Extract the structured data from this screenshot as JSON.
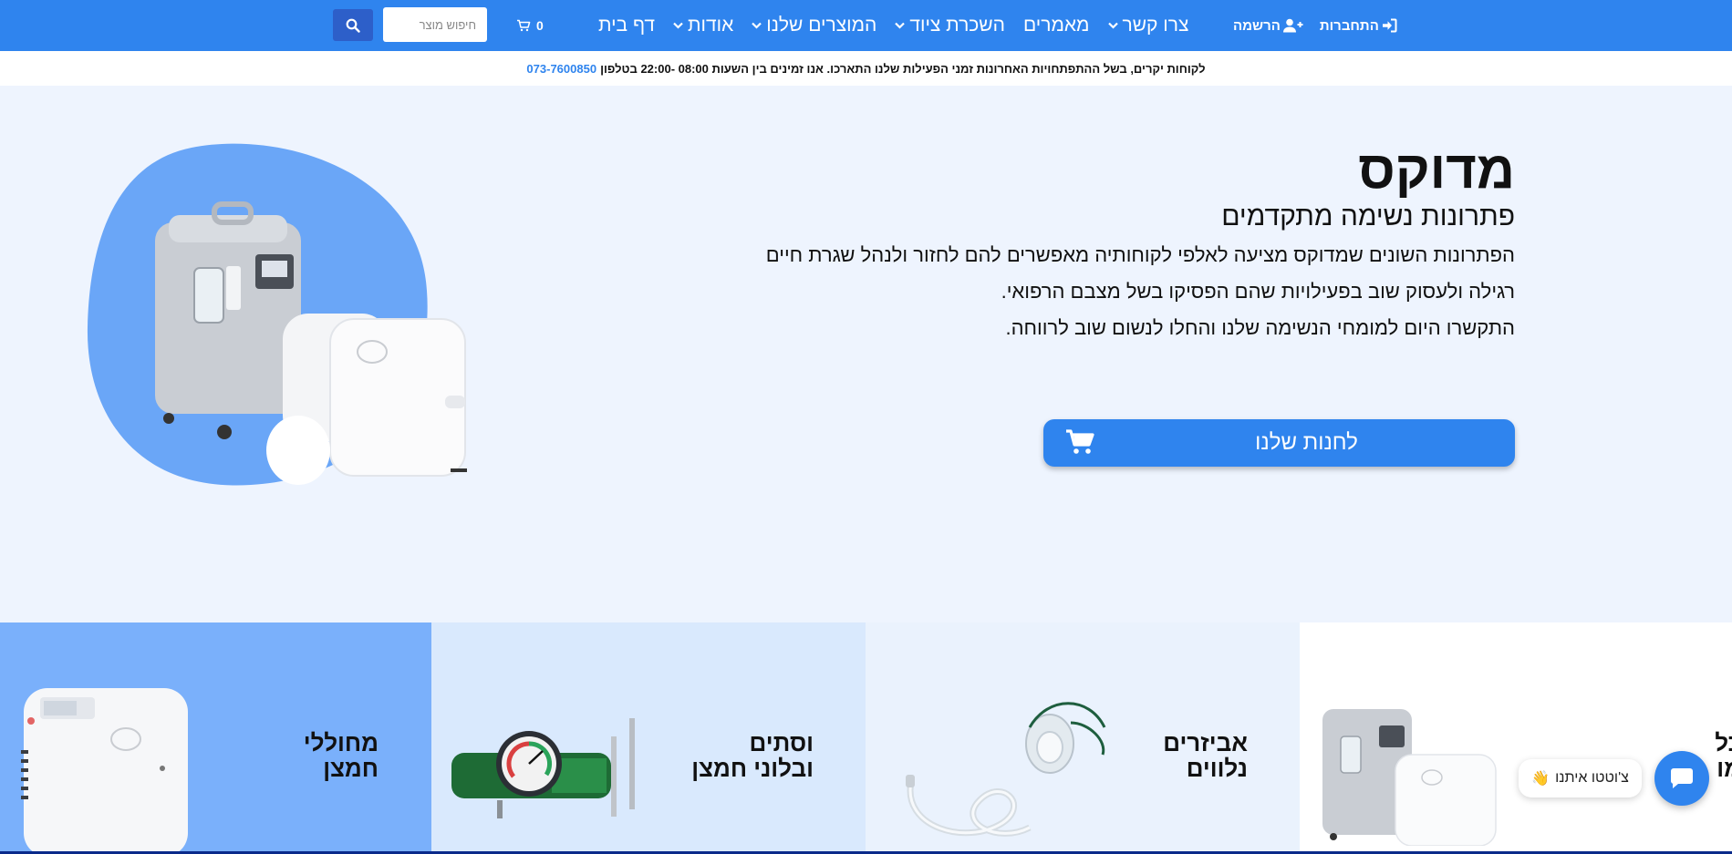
{
  "header": {
    "search_placeholder": "חיפוש מוצר",
    "cart_count": "0",
    "nav": [
      {
        "label": "דף בית",
        "has_dropdown": false
      },
      {
        "label": "אודות",
        "has_dropdown": true
      },
      {
        "label": "המוצרים שלנו",
        "has_dropdown": true
      },
      {
        "label": "השכרת ציוד",
        "has_dropdown": true
      },
      {
        "label": "מאמרים",
        "has_dropdown": false
      },
      {
        "label": "צרו קשר",
        "has_dropdown": true
      }
    ],
    "auth": {
      "register": "הרשמה",
      "login": "התחברות"
    }
  },
  "notice": {
    "text": "לקוחות יקרים, בשל ההתפתחויות האחרונות זמני הפעילות שלנו התארכו. אנו זמינים בין השעות 08:00 -22:00 בטלפון",
    "phone": "073-7600850"
  },
  "hero": {
    "title": "מדוקס",
    "subtitle": "פתרונות נשימה מתקדמים",
    "description_lines": [
      "הפתרונות השונים שמדוקס מציעה לאלפי לקוחותיה מאפשרים להם לחזור ולנהל שגרת חיים",
      "רגילה ולעסוק שוב בפעילויות שהם הפסיקו בשל מצבם הרפואי.",
      "התקשרו היום למומחי הנשימה שלנו והחלו לנשום שוב לרווחה."
    ],
    "cta_label": "לחנות שלנו"
  },
  "categories": [
    {
      "title_line1": "מחוללי",
      "title_line2": "חמצן",
      "bg": "#7ab0fb"
    },
    {
      "title_line1": "וסתים",
      "title_line2": "ובלוני חמצן",
      "bg": "#d9e9fd"
    },
    {
      "title_line1": "אביזרים",
      "title_line2": "נלווים",
      "bg": "#eaf2fd"
    },
    {
      "title_line1": "כל",
      "title_line2": "מו",
      "bg": "#ffffff"
    }
  ],
  "chat": {
    "bubble_text": "צ'וטטו איתנו",
    "emoji": "👋"
  },
  "colors": {
    "primary": "#2f84ee",
    "search_button": "#2d5fc9",
    "hero_bg": "#eef4fe",
    "blob": "#6aa6f7"
  }
}
